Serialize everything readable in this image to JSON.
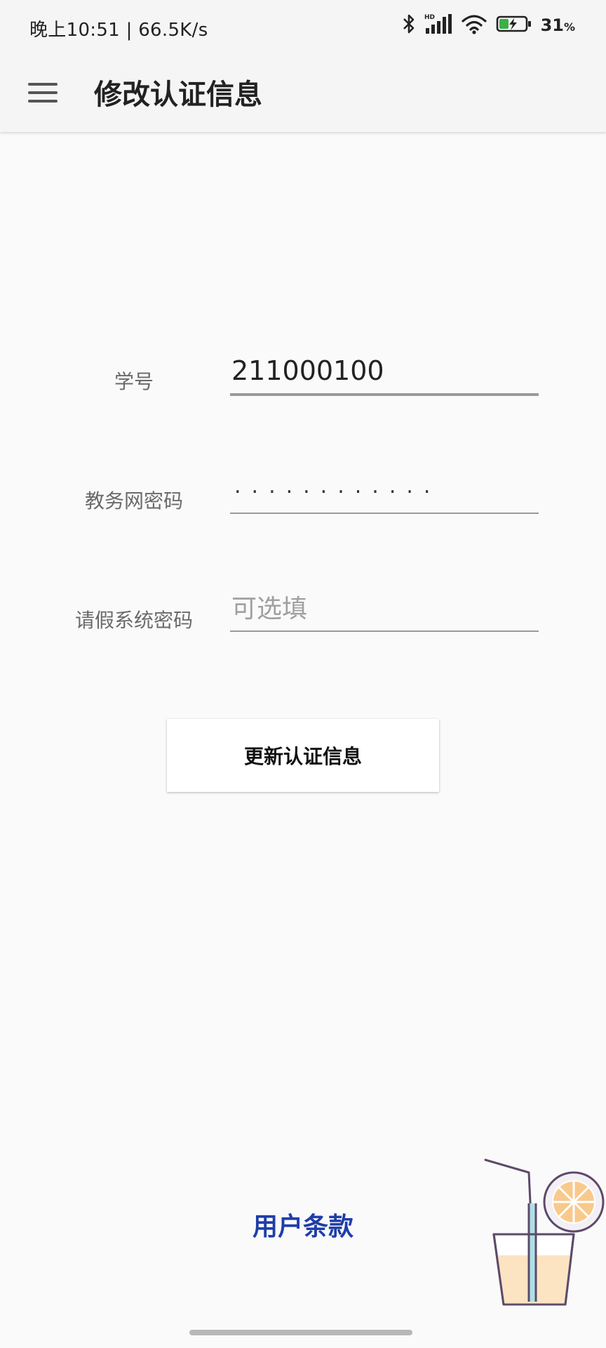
{
  "status_bar": {
    "time_speed": "晚上10:51 | 66.5K/s",
    "battery_percent": "31",
    "battery_unit": "%",
    "icons": [
      "bluetooth-icon",
      "hd-signal-icon",
      "wifi-icon",
      "battery-charging-icon"
    ]
  },
  "app_bar": {
    "title": "修改认证信息",
    "menu_icon": "hamburger-menu-icon"
  },
  "form": {
    "student_id": {
      "label": "学号",
      "value": "211000100"
    },
    "academic_password": {
      "label": "教务网密码",
      "masked": "............"
    },
    "leave_password": {
      "label": "请假系统密码",
      "placeholder": "可选填"
    }
  },
  "update_button": {
    "label": "更新认证信息"
  },
  "footer": {
    "terms_link": "用户条款",
    "decoration_icon": "juice-cup-icon"
  },
  "colors": {
    "background": "#fafafa",
    "bar": "#f5f5f5",
    "link": "#1f3ea8",
    "underline": "#9a9a9a"
  }
}
